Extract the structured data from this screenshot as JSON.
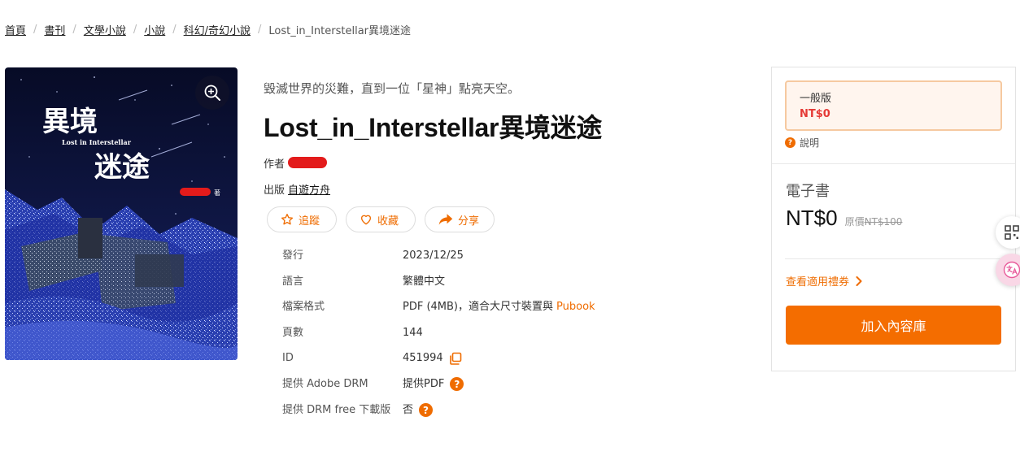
{
  "breadcrumb": {
    "items": [
      "首頁",
      "書刊",
      "文學小說",
      "小說",
      "科幻/奇幻小說"
    ],
    "current": "Lost_in_Interstellar異境迷途",
    "separator": "/"
  },
  "book": {
    "tagline": "毀滅世界的災難，直到一位「星神」點亮天空。",
    "title": "Lost_in_Interstellar異境迷途",
    "author_label": "作者",
    "publisher_label": "出版",
    "publisher": "自遊方舟",
    "cover": {
      "title_line1": "異境",
      "title_sub": "Lost in Interstellar",
      "title_line2": "迷途",
      "author_suffix": "著"
    }
  },
  "actions": {
    "follow": "追蹤",
    "collect": "收藏",
    "share": "分享"
  },
  "specs": {
    "release_label": "發行",
    "release_value": "2023/12/25",
    "language_label": "語言",
    "language_value": "繁體中文",
    "format_label": "檔案格式",
    "format_value": "PDF (4MB)，適合大尺寸裝置與",
    "format_link": "Pubook",
    "pages_label": "頁數",
    "pages_value": "144",
    "id_label": "ID",
    "id_value": "451994",
    "adobe_drm_label": "提供 Adobe DRM",
    "adobe_drm_value": "提供PDF",
    "drm_free_label": "提供 DRM free 下載版",
    "drm_free_value": "否"
  },
  "panel": {
    "edition_name": "一般版",
    "edition_price": "NT$0",
    "explain": "說明",
    "ebook_label": "電子書",
    "price": "NT$0",
    "orig_label": "原價",
    "orig_price": "NT$100",
    "voucher_link": "查看適用禮券",
    "add_button": "加入內容庫"
  },
  "colors": {
    "accent": "#f46d00",
    "price_red": "#e53935",
    "cover_bg": "#0c1133"
  },
  "icons": {
    "zoom": "zoom-in-icon",
    "follow": "star-icon",
    "collect": "heart-icon",
    "share": "share-arrow-icon",
    "copy": "copy-icon",
    "help": "question-circle-icon",
    "voucher": "chevron-right-icon",
    "qr": "qr-grid-icon",
    "translate": "translate-icon"
  }
}
